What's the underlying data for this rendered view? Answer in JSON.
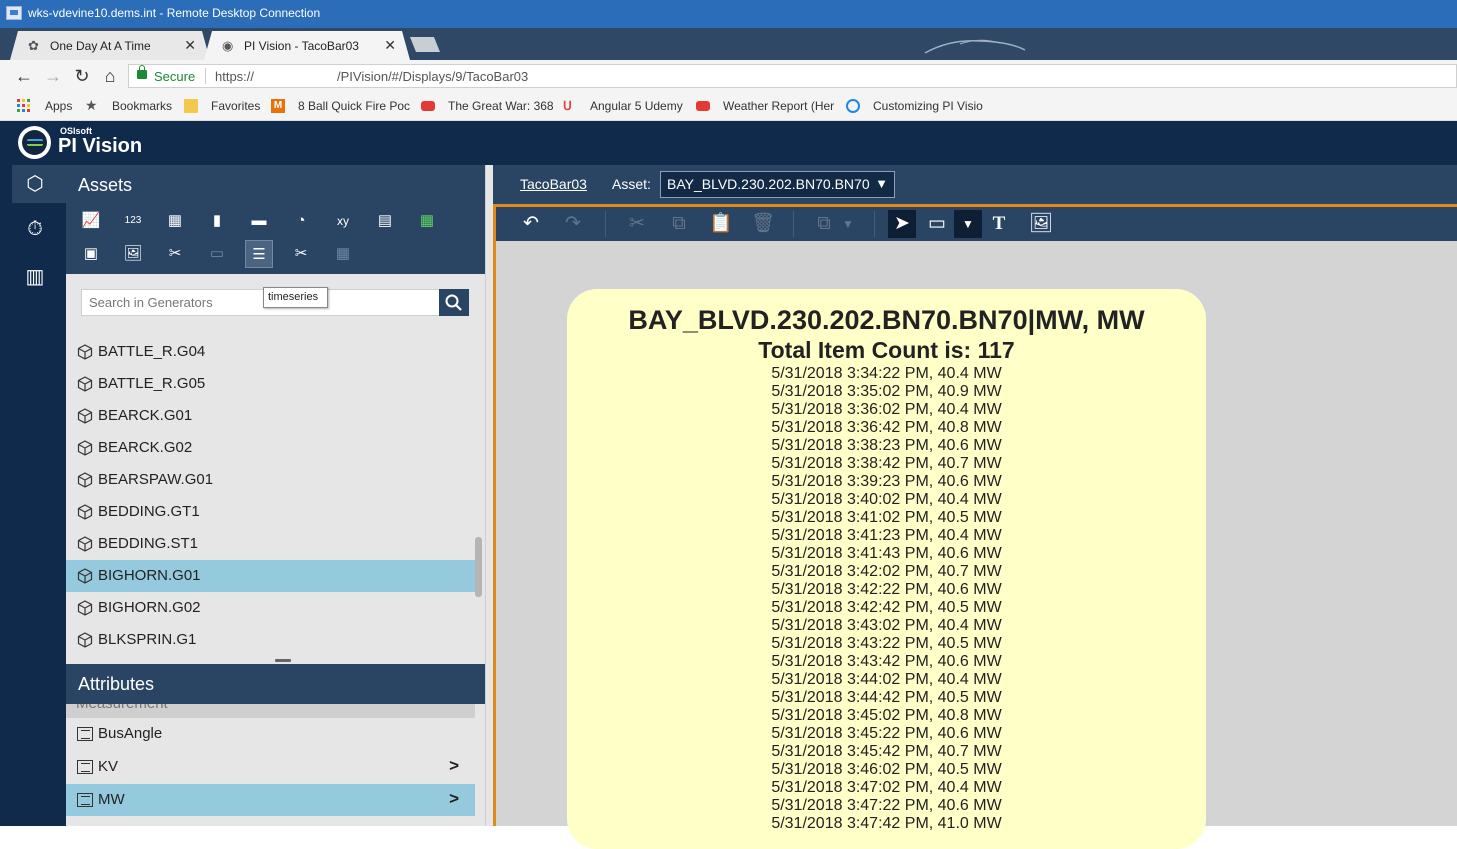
{
  "rdp": {
    "title": "wks-vdevine10.dems.int - Remote Desktop Connection"
  },
  "browser": {
    "tabs": [
      {
        "label": "One Day At A Time",
        "active": false
      },
      {
        "label": "PI Vision - TacoBar03",
        "active": true
      }
    ],
    "secure_label": "Secure",
    "url_scheme": "https://",
    "url_path": "/PIVision/#/Displays/9/TacoBar03",
    "bookmarks": [
      {
        "label": "Apps",
        "icon": "apps-grid-icon"
      },
      {
        "label": "Bookmarks",
        "icon": "star-icon"
      },
      {
        "label": "Favorites",
        "icon": "folder-icon"
      },
      {
        "label": "8 Ball Quick Fire Poc",
        "icon": "gmail-icon"
      },
      {
        "label": "The Great War: 368",
        "icon": "youtube-icon"
      },
      {
        "label": "Angular 5 Udemy",
        "icon": "udemy-icon"
      },
      {
        "label": "Weather Report (Her",
        "icon": "youtube-icon"
      },
      {
        "label": "Customizing PI Visio",
        "icon": "pi-icon"
      }
    ]
  },
  "app": {
    "vendor": "OSIsoft",
    "name": "PI Vision"
  },
  "assets": {
    "title": "Assets",
    "search_placeholder": "Search in Generators",
    "tooltip": "timeseries",
    "items": [
      {
        "label": "BATTLE_R.G04",
        "selected": false
      },
      {
        "label": "BATTLE_R.G05",
        "selected": false
      },
      {
        "label": "BEARCK.G01",
        "selected": false
      },
      {
        "label": "BEARCK.G02",
        "selected": false
      },
      {
        "label": "BEARSPAW.G01",
        "selected": false
      },
      {
        "label": "BEDDING.GT1",
        "selected": false
      },
      {
        "label": "BEDDING.ST1",
        "selected": false
      },
      {
        "label": "BIGHORN.G01",
        "selected": true
      },
      {
        "label": "BIGHORN.G02",
        "selected": false
      },
      {
        "label": "BLKSPRIN.G1",
        "selected": false
      }
    ]
  },
  "attributes": {
    "title": "Attributes",
    "cut_item": "Measurement",
    "items": [
      {
        "label": "BusAngle",
        "expandable": false,
        "selected": false
      },
      {
        "label": "KV",
        "expandable": true,
        "selected": false
      },
      {
        "label": "MW",
        "expandable": true,
        "selected": true
      }
    ]
  },
  "display": {
    "name": "TacoBar03",
    "asset_label": "Asset:",
    "asset_value": "BAY_BLVD.230.202.BN70.BN70"
  },
  "card": {
    "title": "BAY_BLVD.230.202.BN70.BN70|MW, MW",
    "count": "Total Item Count is: 117",
    "rows": [
      "5/31/2018 3:34:22 PM, 40.4 MW",
      "5/31/2018 3:35:02 PM, 40.9 MW",
      "5/31/2018 3:36:02 PM, 40.4 MW",
      "5/31/2018 3:36:42 PM, 40.8 MW",
      "5/31/2018 3:38:23 PM, 40.6 MW",
      "5/31/2018 3:38:42 PM, 40.7 MW",
      "5/31/2018 3:39:23 PM, 40.6 MW",
      "5/31/2018 3:40:02 PM, 40.4 MW",
      "5/31/2018 3:41:02 PM, 40.5 MW",
      "5/31/2018 3:41:23 PM, 40.4 MW",
      "5/31/2018 3:41:43 PM, 40.6 MW",
      "5/31/2018 3:42:02 PM, 40.7 MW",
      "5/31/2018 3:42:22 PM, 40.6 MW",
      "5/31/2018 3:42:42 PM, 40.5 MW",
      "5/31/2018 3:43:02 PM, 40.4 MW",
      "5/31/2018 3:43:22 PM, 40.5 MW",
      "5/31/2018 3:43:42 PM, 40.6 MW",
      "5/31/2018 3:44:02 PM, 40.4 MW",
      "5/31/2018 3:44:42 PM, 40.5 MW",
      "5/31/2018 3:45:02 PM, 40.8 MW",
      "5/31/2018 3:45:22 PM, 40.6 MW",
      "5/31/2018 3:45:42 PM, 40.7 MW",
      "5/31/2018 3:46:02 PM, 40.5 MW",
      "5/31/2018 3:47:02 PM, 40.4 MW",
      "5/31/2018 3:47:22 PM, 40.6 MW",
      "5/31/2018 3:47:42 PM, 41.0 MW"
    ]
  },
  "colors": {
    "header_dark": "#0f2a4b",
    "panel_blue": "#2a4563",
    "selection": "#95c9dd",
    "card_bg": "#ffffc8",
    "accent_orange": "#e08a1e"
  }
}
